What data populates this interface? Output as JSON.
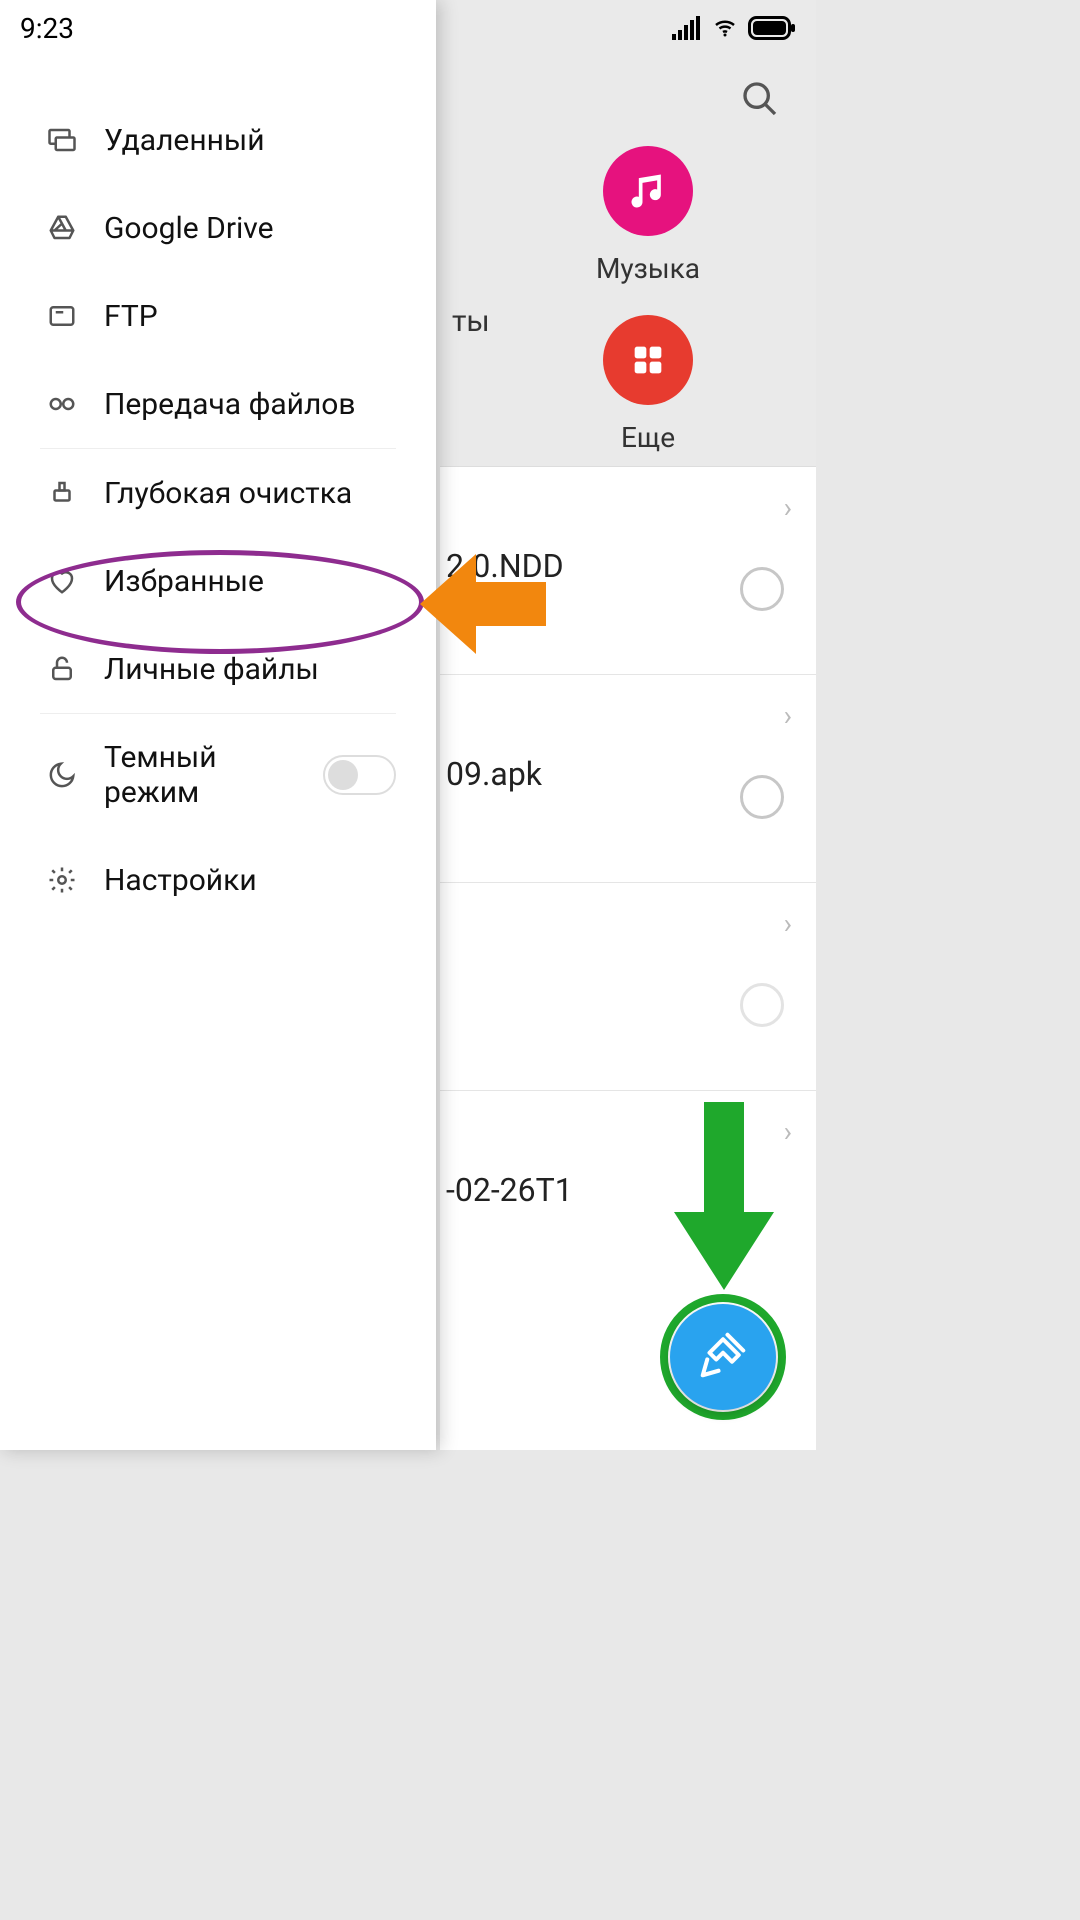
{
  "status": {
    "time": "9:23"
  },
  "underlay": {
    "partial_category_label": "ты",
    "categories": [
      {
        "key": "music",
        "label": "Музыка",
        "color": "#e6127e"
      },
      {
        "key": "more",
        "label": "Еще",
        "color": "#e73b2f"
      }
    ],
    "files": [
      {
        "name": "2.0.NDD"
      },
      {
        "name": "09.apk"
      },
      {
        "name": ""
      },
      {
        "name": "-02-26T1"
      }
    ]
  },
  "drawer": {
    "items": [
      {
        "key": "remote",
        "label": "Удаленный",
        "icon": "monitor"
      },
      {
        "key": "gdrive",
        "label": "Google Drive",
        "icon": "drive"
      },
      {
        "key": "ftp",
        "label": "FTP",
        "icon": "ftp"
      },
      {
        "key": "transfer",
        "label": "Передача файлов",
        "icon": "link",
        "sep_after": true
      },
      {
        "key": "deep_clean",
        "label": "Глубокая очистка",
        "icon": "broom",
        "highlighted": true
      },
      {
        "key": "favorites",
        "label": "Избранные",
        "icon": "heart"
      },
      {
        "key": "private",
        "label": "Личные файлы",
        "icon": "lock",
        "sep_after": true
      },
      {
        "key": "dark",
        "label": "Темный режим",
        "icon": "moon",
        "toggle": true,
        "toggle_on": false
      },
      {
        "key": "settings",
        "label": "Настройки",
        "icon": "gear"
      }
    ]
  },
  "annotations": {
    "ellipse_color": "#8e2c8f",
    "arrow_orange_color": "#f2870e",
    "arrow_green_color": "#1fa82c"
  }
}
